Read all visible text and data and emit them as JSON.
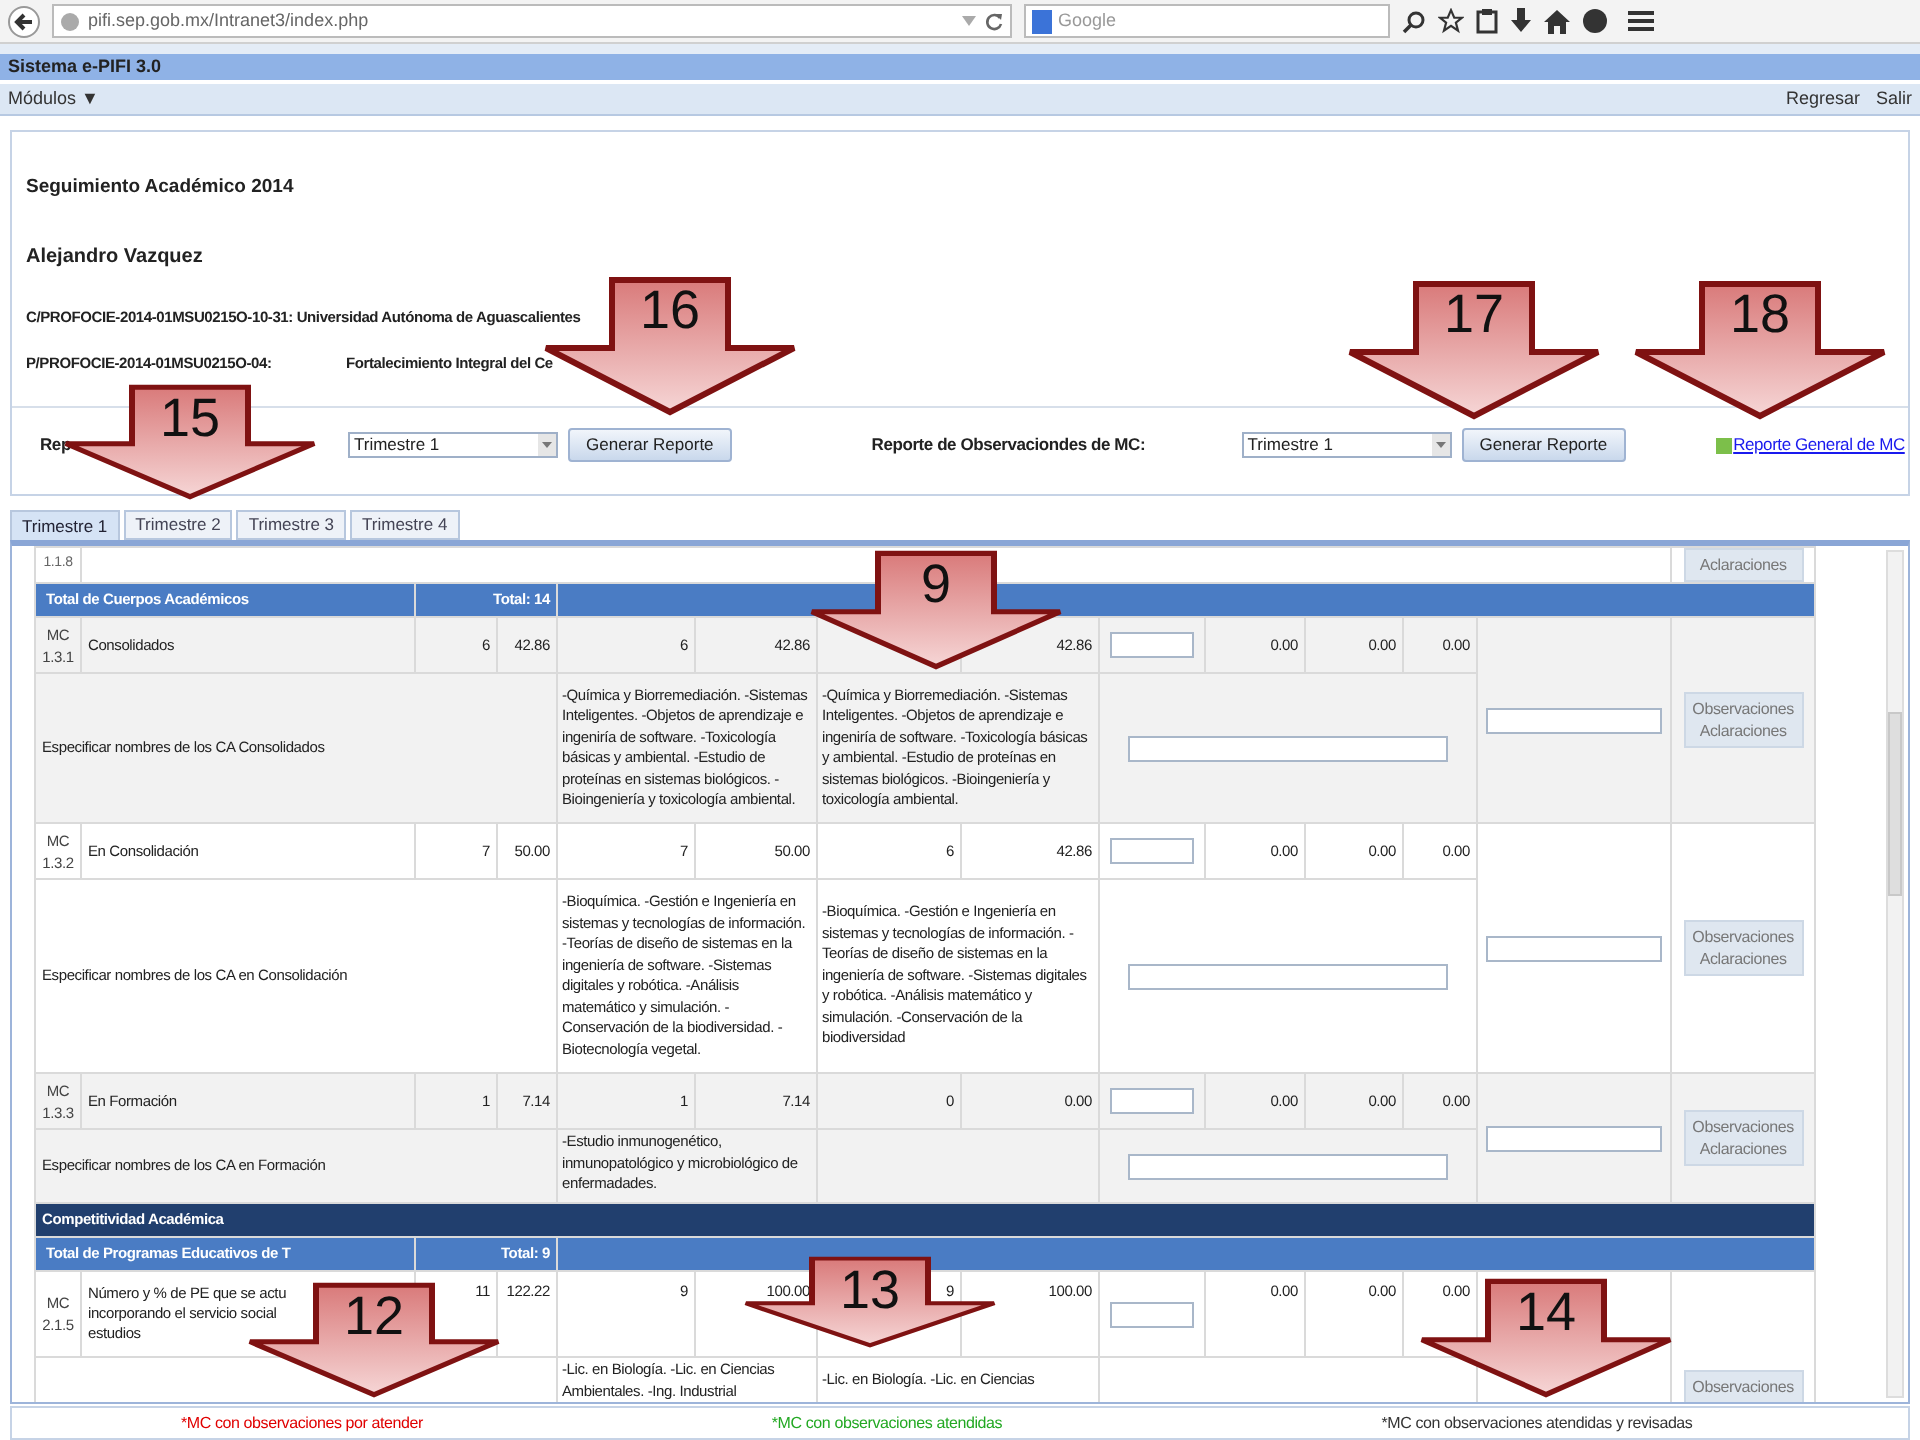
{
  "browser": {
    "url": "pifi.sep.gob.mx/Intranet3/index.php",
    "search_placeholder": "Google"
  },
  "app": {
    "title": "Sistema e-PIFI 3.0",
    "menu": "Módulos",
    "menu_caret": "▼",
    "links": [
      "Regresar",
      "Salir"
    ]
  },
  "header": {
    "title": "Seguimiento Académico 2014",
    "person": "Alejandro Vazquez",
    "line_1": "C/PROFOCIE-2014-01MSU0215O-10-31: Universidad Autónoma de Aguascalientes",
    "line_2_code": "P/PROFOCIE-2014-01MSU0215O-04:",
    "line_2_name": "Fortalecimiento Integral del Ce",
    "reports": [
      {
        "label": "Rep",
        "select": "Trimestre 1",
        "button": "Generar Reporte"
      },
      {
        "label": "Reporte de Observaciondes de MC:",
        "select": "Trimestre 1",
        "button": "Generar Reporte"
      }
    ],
    "general_link": "Reporte General de MC"
  },
  "tabs": [
    {
      "label": "Trimestre 1",
      "selected": true
    },
    {
      "label": "Trimestre 2",
      "selected": false
    },
    {
      "label": "Trimestre 3",
      "selected": false
    },
    {
      "label": "Trimestre 4",
      "selected": false
    }
  ],
  "table": {
    "rows": [
      {
        "kind": "partial",
        "code": "1.1.8",
        "button": "Aclaraciones"
      },
      {
        "kind": "group",
        "label": "Total de Cuerpos Académicos",
        "total": "Total: 14"
      },
      {
        "kind": "metric",
        "code": "MC 1.3.1",
        "label": "Consolidados",
        "pairs": [
          [
            "6",
            "42.86"
          ],
          [
            "6",
            "42.86"
          ],
          [
            "42.86"
          ]
        ],
        "extra": [
          "0.00",
          "0.00",
          "0.00"
        ],
        "button": "Observaciones Aclaraciones"
      },
      {
        "kind": "detail",
        "label": "Especificar nombres de los CA Consolidados",
        "text_a": "-Química y Biorremediación. -Sistemas Inteligentes. -Objetos de aprendizaje e ingeniría de software. -Toxicología básicas y ambiental. -Estudio de proteínas en sistemas biológicos. -Bioingeniería y toxicología ambiental.",
        "text_b": "-Química y Biorremediación. -Sistemas Inteligentes. -Objetos de aprendizaje e ingeniría de software. -Toxicología básicas y ambiental. -Estudio de proteínas en sistemas biológicos. -Bioingeniería y toxicología ambiental."
      },
      {
        "kind": "metric",
        "code": "MC 1.3.2",
        "label": "En Consolidación",
        "pairs": [
          [
            "7",
            "50.00"
          ],
          [
            "7",
            "50.00"
          ],
          [
            "6",
            "42.86"
          ]
        ],
        "extra": [
          "0.00",
          "0.00",
          "0.00"
        ],
        "button": "Observaciones Aclaraciones"
      },
      {
        "kind": "detail",
        "label": "Especificar nombres de los CA en Consolidación",
        "text_a": "-Bioquímica. -Gestión e Ingeniería en sistemas y tecnologías de información. -Teorías de diseño de sistemas en la ingeniería de software. -Sistemas digitales y robótica. -Análisis matemático y simulación. -Conservación de la biodiversidad. -Biotecnología vegetal.",
        "text_b": "-Bioquímica. -Gestión e Ingeniería en sistemas y tecnologías de información. -Teorías de diseño de sistemas en la ingeniería de software. -Sistemas digitales y robótica. -Análisis matemático y simulación. -Conservación de la biodiversidad"
      },
      {
        "kind": "metric",
        "code": "MC 1.3.3",
        "label": "En Formación",
        "pairs": [
          [
            "1",
            "7.14"
          ],
          [
            "1",
            "7.14"
          ],
          [
            "0",
            "0.00"
          ]
        ],
        "extra": [
          "0.00",
          "0.00",
          "0.00"
        ],
        "button": "Observaciones Aclaraciones"
      },
      {
        "kind": "detail",
        "label": "Especificar nombres de los CA en Formación",
        "text_a": "-Estudio inmunogenético, inmunopatológico y microbiológico de enfermadades."
      },
      {
        "kind": "section",
        "label": "Competitividad Académica"
      },
      {
        "kind": "group",
        "label": "Total de Programas Educativos de T",
        "total": "Total: 9"
      },
      {
        "kind": "metric",
        "code": "MC 2.1.5",
        "label_lines": [
          "Número y % de PE que se actu",
          "incorporando el servicio social",
          "estudios"
        ],
        "pairs": [
          [
            "11",
            "122.22"
          ],
          [
            "9",
            "100.00"
          ],
          [
            "9",
            "100.00"
          ]
        ],
        "extra": [
          "0.00",
          "0.00",
          "0.00"
        ],
        "button": "Observaciones"
      },
      {
        "kind": "detail",
        "text_a": "-Lic. en Biología. -Lic. en Ciencias Ambientales. -Ing. Industrial",
        "text_b": "-Lic. en Biología. -Lic. en Ciencias"
      }
    ]
  },
  "legend": [
    {
      "text": "*MC con observaciones por atender",
      "color": "#e00000"
    },
    {
      "text": "*MC con observaciones atendidas",
      "color": "#22a822"
    },
    {
      "text": "*MC con observaciones atendidas y revisadas",
      "color": "#333333"
    }
  ],
  "callouts": [
    {
      "number": "15"
    },
    {
      "number": "16"
    },
    {
      "number": "17"
    },
    {
      "number": "18"
    },
    {
      "number": "9"
    },
    {
      "number": "12"
    },
    {
      "number": "13"
    },
    {
      "number": "14"
    }
  ]
}
